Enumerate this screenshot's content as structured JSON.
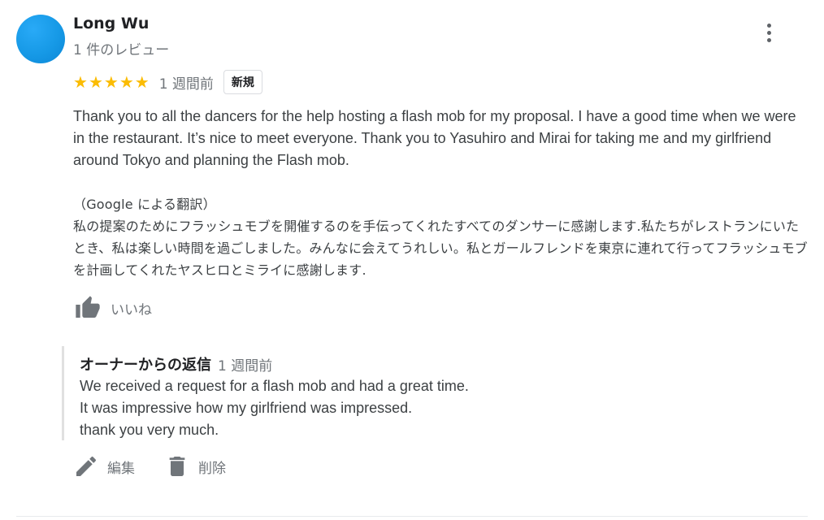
{
  "reviewer": {
    "name": "Long Wu",
    "review_count": "1 件のレビュー"
  },
  "rating": {
    "stars": 5,
    "time": "1 週間前",
    "badge": "新規"
  },
  "review": {
    "text": "Thank you to all the dancers for the help hosting a flash mob for my proposal. I have a good time when we were in the restaurant. It’s nice to meet everyone. Thank you to Yasuhiro and Mirai for taking me and my girlfriend around Tokyo and planning the Flash mob.",
    "translation_header": "（Google による翻訳）",
    "translation": "私の提案のためにフラッシュモブを開催するのを手伝ってくれたすべてのダンサーに感謝します.私たちがレストランにいたとき、私は楽しい時間を過ごしました。みんなに会えてうれしい。私とガールフレンドを東京に連れて行ってフラッシュモブを計画してくれたヤスヒロとミライに感謝します."
  },
  "like": {
    "label": "いいね",
    "icon": "thumbs-up-icon"
  },
  "owner_reply": {
    "title": "オーナーからの返信",
    "time": "1 週間前",
    "lines": [
      "We received a request for a flash mob and had a great time.",
      "It was impressive how my girlfriend was impressed.",
      "thank you very much."
    ]
  },
  "actions": {
    "edit_label": "編集",
    "edit_icon": "pencil-icon",
    "delete_label": "削除",
    "delete_icon": "trash-icon"
  },
  "colors": {
    "star": "#fbbc04",
    "avatar": "#1699e6",
    "icon": "#70757a"
  }
}
